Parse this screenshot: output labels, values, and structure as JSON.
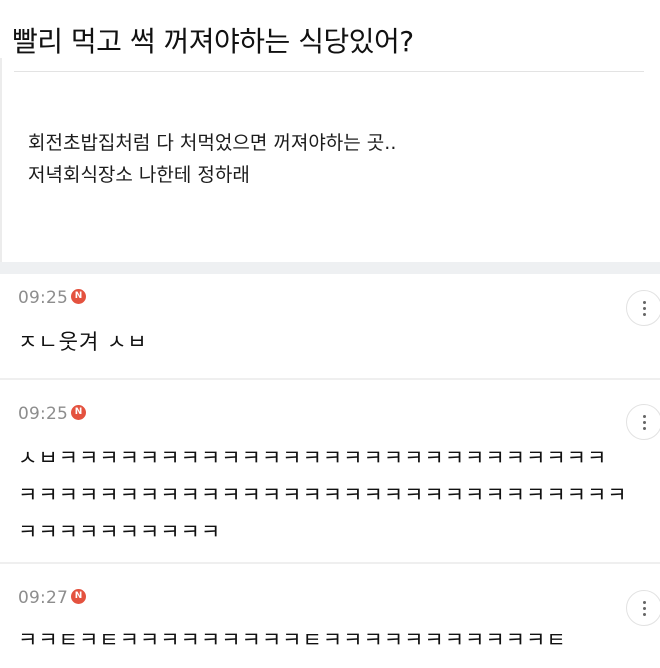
{
  "post": {
    "title": "빨리 먹고 썩 꺼져야하는 식당있어?",
    "body_lines": [
      "회전초밥집처럼 다 처먹었으면 꺼져야하는 곳..",
      "저녁회식장소 나한테 정하래"
    ]
  },
  "comments": [
    {
      "time": "09:25",
      "badge": "N",
      "lines": [
        "ㅈㄴ웃겨 ㅅㅂ"
      ]
    },
    {
      "time": "09:25",
      "badge": "N",
      "lines": [
        "ㅅㅂㅋㅋㅋㅋㅋㅋㅋㅋㅋㅋㅋㅋㅋㅋㅋㅋㅋㅋㅋㅋㅋㅋㅋㅋㅋㅋㅋ",
        "ㅋㅋㅋㅋㅋㅋㅋㅋㅋㅋㅋㅋㅋㅋㅋㅋㅋㅋㅋㅋㅋㅋㅋㅋㅋㅋㅋㅋㅋㅋ",
        "ㅋㅋㅋㅋㅋㅋㅋㅋㅋㅋ"
      ]
    },
    {
      "time": "09:27",
      "badge": "N",
      "lines": [
        "ㅋㅋㅌㅋㅌㅋㅋㅋㅋㅋㅋㅋㅋㅋㅌㅋㅋㅋㅋㅋㅋㅋㅋㅋㅋㅋㅌ"
      ]
    }
  ],
  "icons": {
    "new_badge": "new-badge-icon",
    "more": "more-vertical-icon"
  },
  "colors": {
    "badge": "#e4523f",
    "timestamp": "#8d8d8d",
    "section_gap": "#eef0f2"
  }
}
